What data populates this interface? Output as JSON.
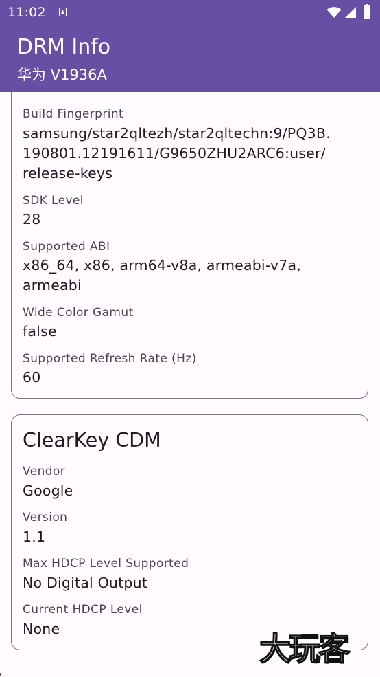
{
  "status_bar": {
    "time": "11:02",
    "icons": [
      "app-notification-icon",
      "wifi-icon",
      "signal-icon",
      "battery-icon"
    ]
  },
  "app_bar": {
    "title": "DRM Info",
    "subtitle": "华为 V1936A",
    "color": "#6750a4"
  },
  "device_card": {
    "fields": [
      {
        "label": "Build Fingerprint",
        "value": "samsung/star2qltezh/star2qltechn:9/PQ3B.\n190801.12191611/G9650ZHU2ARC6:user/\nrelease-keys"
      },
      {
        "label": "SDK Level",
        "value": "28"
      },
      {
        "label": "Supported ABI",
        "value": "x86_64, x86, arm64-v8a, armeabi-v7a,\narmeabi"
      },
      {
        "label": "Wide Color Gamut",
        "value": "false"
      },
      {
        "label": "Supported Refresh Rate (Hz)",
        "value": "60"
      }
    ]
  },
  "clearkey_card": {
    "title": "ClearKey CDM",
    "fields": [
      {
        "label": "Vendor",
        "value": "Google"
      },
      {
        "label": "Version",
        "value": "1.1"
      },
      {
        "label": "Max HDCP Level Supported",
        "value": "No Digital Output"
      },
      {
        "label": "Current HDCP Level",
        "value": "None"
      }
    ]
  },
  "watermark": {
    "text": "大玩客"
  }
}
